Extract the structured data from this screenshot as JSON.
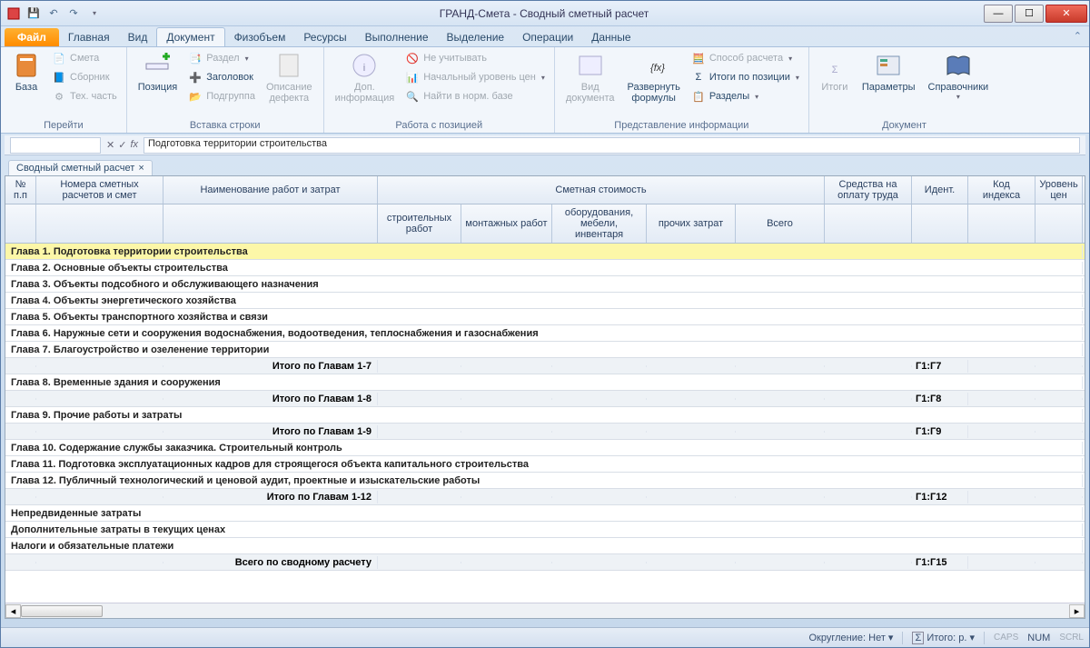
{
  "title": "ГРАНД-Смета - Сводный сметный расчет",
  "tabs": {
    "file": "Файл",
    "list": [
      "Главная",
      "Вид",
      "Документ",
      "Физобъем",
      "Ресурсы",
      "Выполнение",
      "Выделение",
      "Операции",
      "Данные"
    ],
    "active": "Документ"
  },
  "ribbon": {
    "g1": {
      "label": "Перейти",
      "baza": "База",
      "smeta": "Смета",
      "sbornik": "Сборник",
      "teh": "Тех. часть"
    },
    "g2": {
      "label": "Вставка строки",
      "poz": "Позиция",
      "razdel": "Раздел",
      "zag": "Заголовок",
      "podg": "Подгруппа",
      "opis": "Описание\nдефекта"
    },
    "g3": {
      "label": "Работа с позицией",
      "dop": "Доп.\nинформация",
      "neuch": "Не учитывать",
      "nach": "Начальный уровень цен",
      "najti": "Найти в норм. базе"
    },
    "g4": {
      "label": "Представление информации",
      "vid": "Вид\nдокумента",
      "razv": "Развернуть\nформулы",
      "sposob": "Способ расчета",
      "itogi": "Итоги по позиции",
      "razd": "Разделы"
    },
    "g5": {
      "label": "Документ",
      "itogi": "Итоги",
      "param": "Параметры",
      "sprav": "Справочники"
    }
  },
  "formula": "Подготовка территории строительства",
  "doctab": "Сводный сметный расчет",
  "headers": {
    "np": "№\nп.п",
    "num": "Номера сметных\nрасчетов и смет",
    "name": "Наименование работ и затрат",
    "cost": "Сметная стоимость",
    "stro": "строительных\nработ",
    "mont": "монтажных работ",
    "obor": "оборудования,\nмебели, инвентаря",
    "proc": "прочих затрат",
    "vseg": "Всего",
    "sred": "Средства на\nоплату труда",
    "iden": "Идент.",
    "kod": "Код\nиндекса",
    "urov": "Уровень\nцен"
  },
  "rows": [
    {
      "type": "chapter",
      "sel": true,
      "text": "Глава 1. Подготовка территории строительства"
    },
    {
      "type": "chapter",
      "text": "Глава 2. Основные объекты строительства"
    },
    {
      "type": "chapter",
      "text": "Глава 3. Объекты подсобного и обслуживающего назначения"
    },
    {
      "type": "chapter",
      "text": "Глава 4. Объекты энергетического хозяйства"
    },
    {
      "type": "chapter",
      "text": "Глава 5. Объекты транспортного хозяйства и связи"
    },
    {
      "type": "chapter",
      "text": "Глава 6. Наружные сети и сооружения водоснабжения, водоотведения, теплоснабжения и газоснабжения"
    },
    {
      "type": "chapter",
      "text": "Глава 7. Благоустройство и озеленение территории"
    },
    {
      "type": "subtotal",
      "text": "Итого по Главам 1-7",
      "ident": "Г1:Г7"
    },
    {
      "type": "chapter",
      "text": "Глава 8. Временные здания и сооружения"
    },
    {
      "type": "subtotal",
      "text": "Итого по Главам 1-8",
      "ident": "Г1:Г8"
    },
    {
      "type": "chapter",
      "text": "Глава 9. Прочие работы и затраты"
    },
    {
      "type": "subtotal",
      "text": "Итого по Главам 1-9",
      "ident": "Г1:Г9"
    },
    {
      "type": "chapter",
      "text": "Глава 10. Содержание службы заказчика. Строительный контроль"
    },
    {
      "type": "chapter",
      "text": "Глава 11. Подготовка эксплуатационных кадров для строящегося объекта капитального строительства"
    },
    {
      "type": "chapter",
      "text": "Глава 12. Публичный технологический и ценовой аудит, проектные и изыскательские работы"
    },
    {
      "type": "subtotal",
      "text": "Итого по Главам 1-12",
      "ident": "Г1:Г12"
    },
    {
      "type": "chapter",
      "text": "Непредвиденные затраты"
    },
    {
      "type": "chapter",
      "text": "Дополнительные затраты в текущих ценах"
    },
    {
      "type": "chapter",
      "text": "Налоги и обязательные платежи"
    },
    {
      "type": "subtotal",
      "text": "Всего по сводному расчету",
      "ident": "Г1:Г15"
    }
  ],
  "status": {
    "okrug": "Округление: Нет",
    "itogo": "Итого: р.",
    "caps": "CAPS",
    "num": "NUM",
    "scrl": "SCRL"
  }
}
